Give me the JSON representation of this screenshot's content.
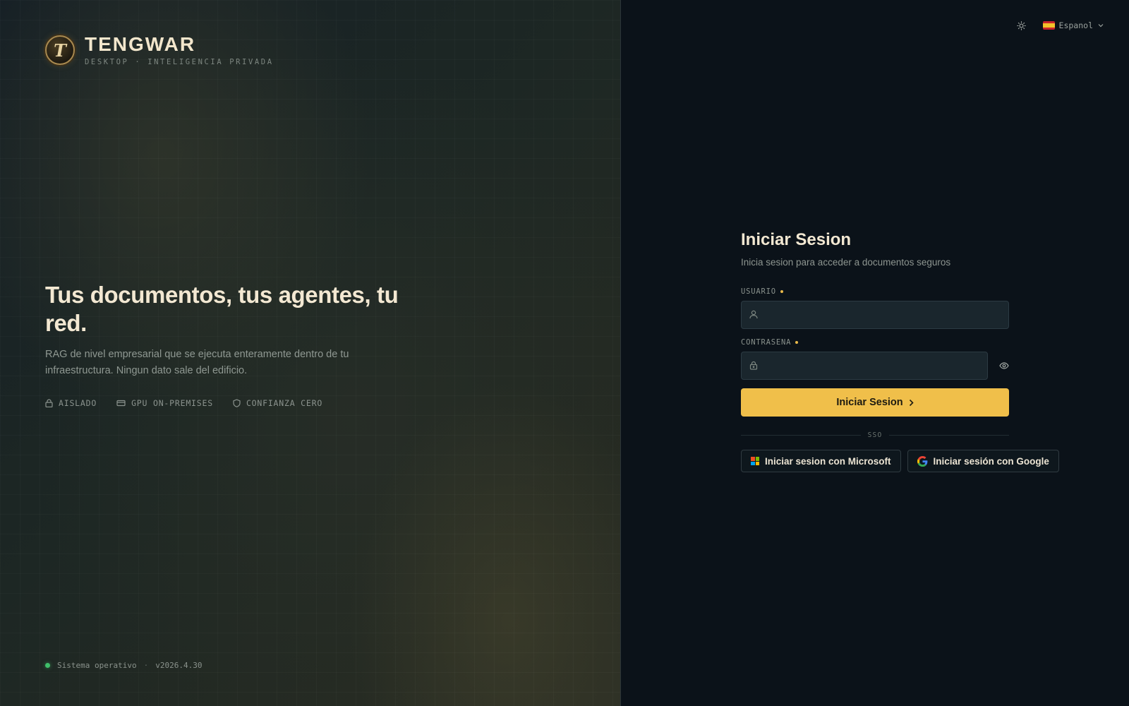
{
  "brand": {
    "logo_glyph": "T",
    "title": "TENGWAR",
    "subtitle": "DESKTOP · INTELIGENCIA PRIVADA"
  },
  "hero": {
    "headline": "Tus documentos, tus agentes, tu red.",
    "lead": "RAG de nivel empresarial que se ejecuta enteramente dentro de tu infraestructura. Ningun dato sale del edificio.",
    "features": [
      {
        "icon": "lock-icon",
        "label": "AISLADO"
      },
      {
        "icon": "gpu-icon",
        "label": "GPU ON-PREMISES"
      },
      {
        "icon": "shield-icon",
        "label": "CONFIANZA CERO"
      }
    ]
  },
  "status": {
    "text": "Sistema operativo",
    "version": "v2026.4.30",
    "color": "#3fbf6a"
  },
  "topbar": {
    "theme_icon": "sun-icon",
    "language": "Espanol",
    "flag": "es-flag"
  },
  "login": {
    "title": "Iniciar Sesion",
    "subtitle": "Inicia sesion para acceder a documentos seguros",
    "username_label": "USUARIO",
    "username_value": "",
    "password_label": "CONTRASENA",
    "password_value": "",
    "submit_label": "Iniciar Sesion",
    "sso_label": "SSO",
    "microsoft_label": "Iniciar sesion con Microsoft",
    "google_label": "Iniciar sesión con Google"
  },
  "colors": {
    "accent": "#f0bf4a",
    "panel_bg": "#0b1219",
    "input_bg": "#1a262d",
    "required_dot": "#e8b84a"
  }
}
